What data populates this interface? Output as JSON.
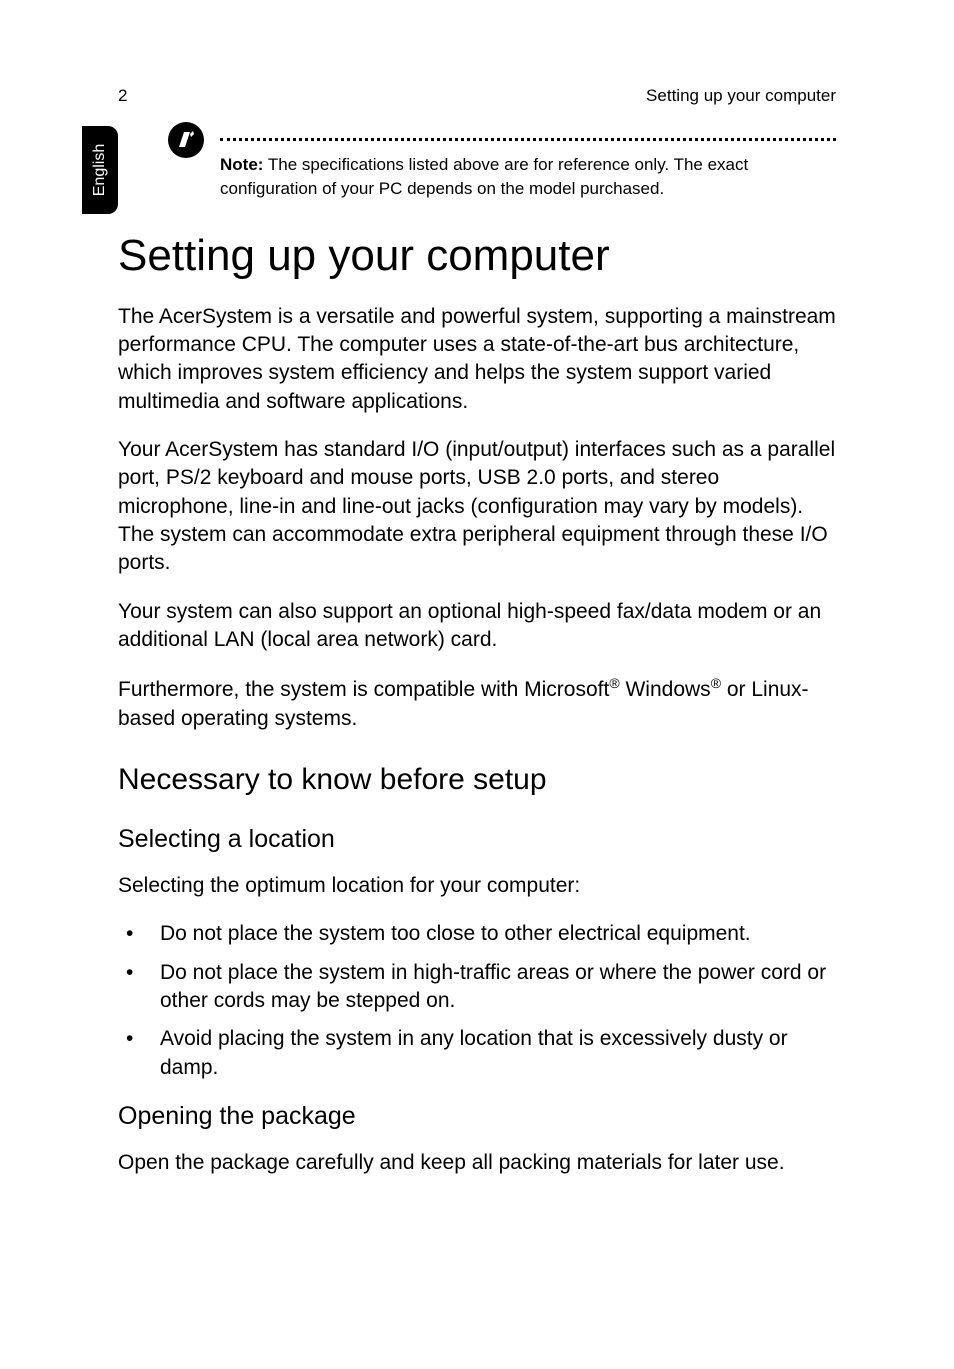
{
  "page_number": "2",
  "running_header": "Setting up your computer",
  "side_tab": "English",
  "note": {
    "bold_label": "Note:",
    "text": " The specifications listed above are for reference only. The exact configuration of your PC depends on the model purchased."
  },
  "heading_main": "Setting up your computer",
  "para1": "The AcerSystem is a versatile and powerful system, supporting a mainstream performance CPU. The computer uses a state-of-the-art bus architecture, which improves system efficiency and helps the system support varied multimedia and software applications.",
  "para2": "Your AcerSystem has standard I/O (input/output) interfaces such as a parallel port, PS/2 keyboard and mouse ports, USB 2.0 ports, and stereo microphone, line-in and line-out jacks (configuration may vary by models). The system can accommodate extra peripheral equipment through these I/O ports.",
  "para3": "Your system can also support an optional high-speed fax/data modem or an additional LAN (local area network) card.",
  "para4_prefix": "Furthermore, the system is compatible with Microsoft",
  "para4_mid": " Windows",
  "para4_suffix": " or Linux-based operating systems.",
  "reg_symbol": "®",
  "heading_section": "Necessary to know before setup",
  "heading_sub1": "Selecting a location",
  "sub1_intro": "Selecting the optimum location for your computer:",
  "bullets": [
    "Do not place the system too close to other electrical equipment.",
    "Do not place the system in high-traffic areas or where the power cord or other cords may be stepped on.",
    "Avoid placing the system in any location that is excessively dusty or damp."
  ],
  "heading_sub2": "Opening the package",
  "sub2_para": "Open the package carefully and keep all packing materials for later use."
}
